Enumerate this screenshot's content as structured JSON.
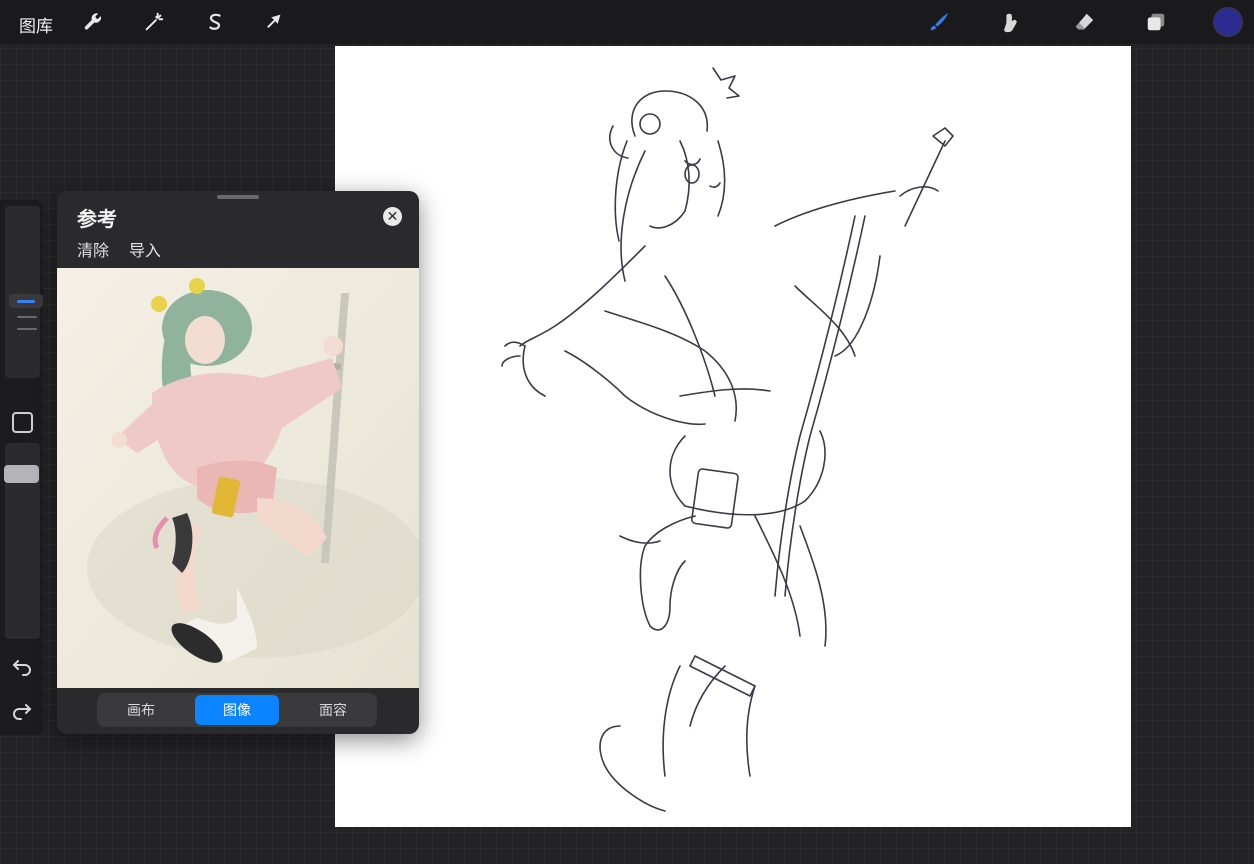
{
  "app": {
    "gallery_label": "图库",
    "accent_color": "#0a84ff",
    "current_color": "#2a2a8f"
  },
  "toolbar": {
    "left_tools": [
      "wrench-icon",
      "magic-wand-icon",
      "selection-icon",
      "transform-icon"
    ],
    "right_tools": [
      "brush-icon",
      "smudge-icon",
      "eraser-icon",
      "layers-icon",
      "color-icon"
    ],
    "active_tool": "brush-icon"
  },
  "reference": {
    "title": "参考",
    "clear_label": "清除",
    "import_label": "导入",
    "tabs": [
      "画布",
      "图像",
      "面容"
    ],
    "active_tab": "图像"
  }
}
